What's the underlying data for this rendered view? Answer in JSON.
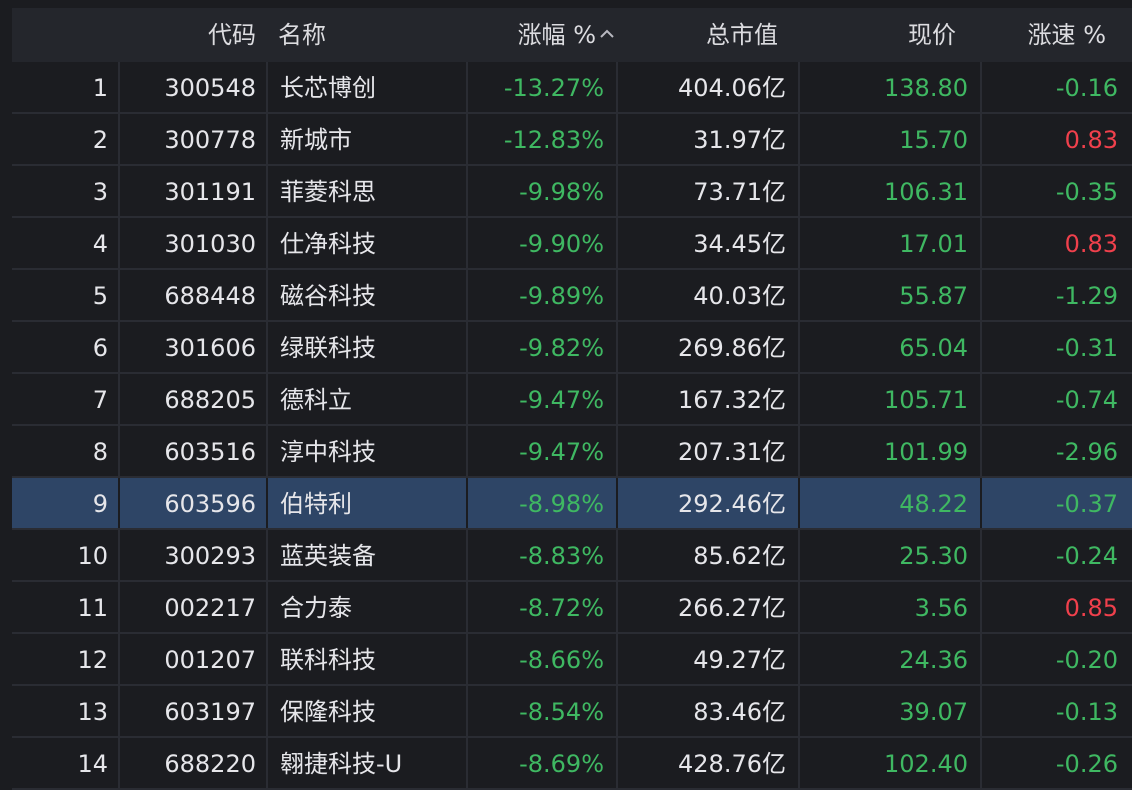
{
  "header": {
    "code": "代码",
    "name": "名称",
    "change_pct": "涨幅 %",
    "market_cap": "总市值",
    "price": "现价",
    "speed_pct": "涨速 %"
  },
  "sort": {
    "column": "change_pct",
    "icon": "caret-up-icon"
  },
  "colors": {
    "background": "#1b1c20",
    "header_bg": "#24262c",
    "selected_row": "#2e4566",
    "up": "#f0404c",
    "down": "#3fb862",
    "text": "#e6e6ea"
  },
  "selected_row_index": 8,
  "rows": [
    {
      "rank": "1",
      "code": "300548",
      "name": "长芯博创",
      "change_pct": "-13.27%",
      "market_cap": "404.06亿",
      "price": "138.80",
      "speed": "-0.16",
      "speed_dir": "down"
    },
    {
      "rank": "2",
      "code": "300778",
      "name": "新城市",
      "change_pct": "-12.83%",
      "market_cap": "31.97亿",
      "price": "15.70",
      "speed": "0.83",
      "speed_dir": "up"
    },
    {
      "rank": "3",
      "code": "301191",
      "name": "菲菱科思",
      "change_pct": "-9.98%",
      "market_cap": "73.71亿",
      "price": "106.31",
      "speed": "-0.35",
      "speed_dir": "down"
    },
    {
      "rank": "4",
      "code": "301030",
      "name": "仕净科技",
      "change_pct": "-9.90%",
      "market_cap": "34.45亿",
      "price": "17.01",
      "speed": "0.83",
      "speed_dir": "up"
    },
    {
      "rank": "5",
      "code": "688448",
      "name": "磁谷科技",
      "change_pct": "-9.89%",
      "market_cap": "40.03亿",
      "price": "55.87",
      "speed": "-1.29",
      "speed_dir": "down"
    },
    {
      "rank": "6",
      "code": "301606",
      "name": "绿联科技",
      "change_pct": "-9.82%",
      "market_cap": "269.86亿",
      "price": "65.04",
      "speed": "-0.31",
      "speed_dir": "down"
    },
    {
      "rank": "7",
      "code": "688205",
      "name": "德科立",
      "change_pct": "-9.47%",
      "market_cap": "167.32亿",
      "price": "105.71",
      "speed": "-0.74",
      "speed_dir": "down"
    },
    {
      "rank": "8",
      "code": "603516",
      "name": "淳中科技",
      "change_pct": "-9.47%",
      "market_cap": "207.31亿",
      "price": "101.99",
      "speed": "-2.96",
      "speed_dir": "down"
    },
    {
      "rank": "9",
      "code": "603596",
      "name": "伯特利",
      "change_pct": "-8.98%",
      "market_cap": "292.46亿",
      "price": "48.22",
      "speed": "-0.37",
      "speed_dir": "down"
    },
    {
      "rank": "10",
      "code": "300293",
      "name": "蓝英装备",
      "change_pct": "-8.83%",
      "market_cap": "85.62亿",
      "price": "25.30",
      "speed": "-0.24",
      "speed_dir": "down"
    },
    {
      "rank": "11",
      "code": "002217",
      "name": "合力泰",
      "change_pct": "-8.72%",
      "market_cap": "266.27亿",
      "price": "3.56",
      "speed": "0.85",
      "speed_dir": "up"
    },
    {
      "rank": "12",
      "code": "001207",
      "name": "联科科技",
      "change_pct": "-8.66%",
      "market_cap": "49.27亿",
      "price": "24.36",
      "speed": "-0.20",
      "speed_dir": "down"
    },
    {
      "rank": "13",
      "code": "603197",
      "name": "保隆科技",
      "change_pct": "-8.54%",
      "market_cap": "83.46亿",
      "price": "39.07",
      "speed": "-0.13",
      "speed_dir": "down"
    },
    {
      "rank": "14",
      "code": "688220",
      "name": "翱捷科技-U",
      "change_pct": "-8.69%",
      "market_cap": "428.76亿",
      "price": "102.40",
      "speed": "-0.26",
      "speed_dir": "down"
    }
  ]
}
